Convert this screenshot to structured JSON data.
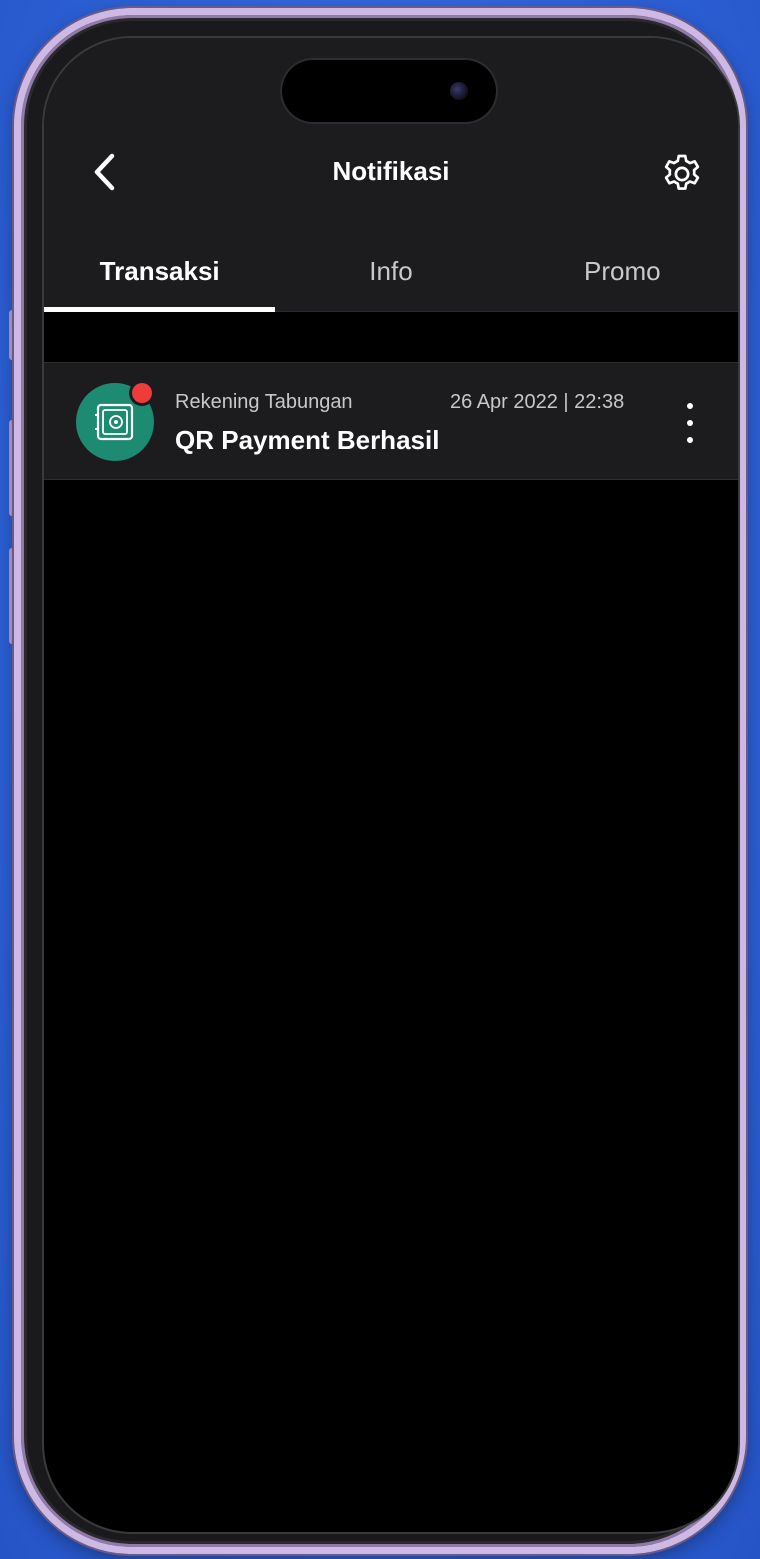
{
  "header": {
    "title": "Notifikasi",
    "back_icon": "chevron-left-icon",
    "settings_icon": "gear-icon"
  },
  "tabs": [
    {
      "label": "Transaksi",
      "active": true
    },
    {
      "label": "Info",
      "active": false
    },
    {
      "label": "Promo",
      "active": false
    }
  ],
  "notifications": [
    {
      "category": "Rekening Tabungan",
      "timestamp": "26 Apr 2022 | 22:38",
      "title": "QR Payment Berhasil",
      "icon": "safe-vault-icon",
      "unread": true
    }
  ],
  "colors": {
    "background": "#000000",
    "header": "#1c1c1e",
    "avatar": "#1d8a72",
    "unread_dot": "#ef3b3b",
    "active_tab_indicator": "#ffffff",
    "wallpaper": "#2f64da"
  }
}
